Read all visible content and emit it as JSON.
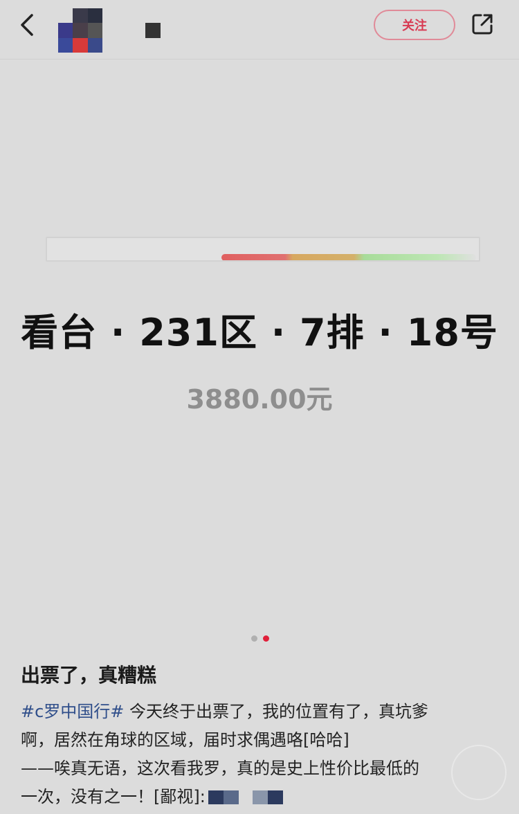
{
  "header": {
    "back_icon": "chevron-left-icon",
    "follow_label": "关注",
    "share_icon": "share-external-icon",
    "accent_color": "#d83a52"
  },
  "ticket": {
    "seat_text": "看台 · 231区 · 7排 · 18号",
    "price_text": "3880.00元"
  },
  "carousel": {
    "total_pages": 2,
    "current_page": 2,
    "active_color": "#e0203a",
    "inactive_color": "#b0b0b0"
  },
  "post": {
    "title": "出票了，真糟糕",
    "hashtag": "#c罗中国行#",
    "line1_rest": " 今天终于出票了，我的位置有了，真坑爹",
    "line2": "啊，居然在角球的区域，届时求偶遇咯[哈哈]",
    "line3": "——唉真无语，这次看我罗，真的是史上性价比最低的",
    "line4": "一次，没有之一！[鄙视]:"
  }
}
